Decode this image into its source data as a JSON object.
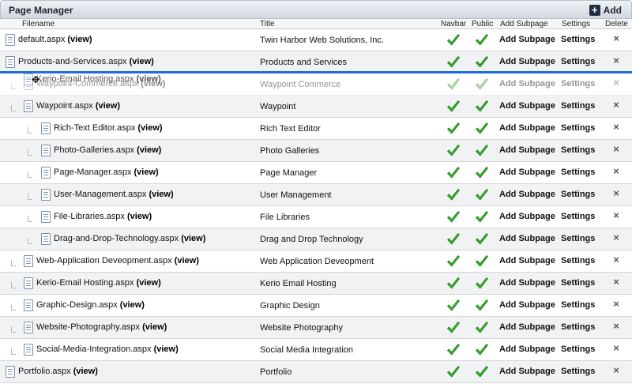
{
  "window": {
    "title": "Page Manager",
    "add_label": "Add"
  },
  "columns": {
    "filename": "Filename",
    "title": "Title",
    "navbar": "Navbar",
    "public": "Public",
    "add_subpage": "Add Subpage",
    "settings": "Settings",
    "delete": "Delete"
  },
  "labels": {
    "view": "(view)",
    "add_subpage": "Add Subpage",
    "settings": "Settings",
    "delete_glyph": "×"
  },
  "drag_ghost": {
    "filename": "Kerio-Email Hosting.aspx",
    "view": "(view)"
  },
  "colors": {
    "check_green": "#36b52c",
    "drop_line": "#1e6fd9"
  },
  "rows": [
    {
      "depth": 0,
      "filename": "default.aspx",
      "title": "Twin Harbor Web Solutions, Inc."
    },
    {
      "depth": 0,
      "filename": "Products-and-Services.aspx",
      "title": "Products and Services"
    },
    {
      "depth": 1,
      "filename": "Waypoint-Commerce.aspx",
      "title": "Waypoint Commerce",
      "drag": true
    },
    {
      "depth": 1,
      "filename": "Waypoint.aspx",
      "title": "Waypoint"
    },
    {
      "depth": 2,
      "filename": "Rich-Text Editor.aspx",
      "title": "Rich Text Editor"
    },
    {
      "depth": 2,
      "filename": "Photo-Galleries.aspx",
      "title": "Photo Galleries"
    },
    {
      "depth": 2,
      "filename": "Page-Manager.aspx",
      "title": "Page Manager"
    },
    {
      "depth": 2,
      "filename": "User-Management.aspx",
      "title": "User Management"
    },
    {
      "depth": 2,
      "filename": "File-Libraries.aspx",
      "title": "File Libraries"
    },
    {
      "depth": 2,
      "filename": "Drag-and-Drop-Technology.aspx",
      "title": "Drag and Drop Technology"
    },
    {
      "depth": 1,
      "filename": "Web-Application Deveopment.aspx",
      "title": "Web Application Deveopment"
    },
    {
      "depth": 1,
      "filename": "Kerio-Email Hosting.aspx",
      "title": "Kerio Email Hosting"
    },
    {
      "depth": 1,
      "filename": "Graphic-Design.aspx",
      "title": "Graphic Design"
    },
    {
      "depth": 1,
      "filename": "Website-Photography.aspx",
      "title": "Website Photography"
    },
    {
      "depth": 1,
      "filename": "Social-Media-Integration.aspx",
      "title": "Social Media Integration"
    },
    {
      "depth": 0,
      "filename": "Portfolio.aspx",
      "title": "Portfolio"
    }
  ]
}
